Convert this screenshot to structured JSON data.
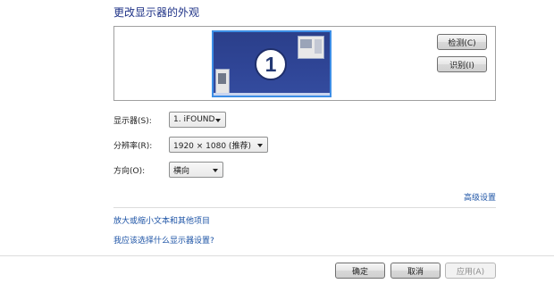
{
  "page": {
    "title": "更改显示器的外观"
  },
  "preview": {
    "monitor_number": "1",
    "detect_label": "检测(C)",
    "identify_label": "识别(I)"
  },
  "form": {
    "display": {
      "label": "显示器(S):",
      "value": "1. iFOUND"
    },
    "resolution": {
      "label": "分辨率(R):",
      "value": "1920 × 1080 (推荐)"
    },
    "orientation": {
      "label": "方向(O):",
      "value": "横向"
    }
  },
  "links": {
    "advanced": "高级设置",
    "magnify": "放大或缩小文本和其他项目",
    "which_settings": "我应该选择什么显示器设置?"
  },
  "footer": {
    "ok_label": "确定",
    "cancel_label": "取消",
    "apply_label": "应用(A)"
  }
}
